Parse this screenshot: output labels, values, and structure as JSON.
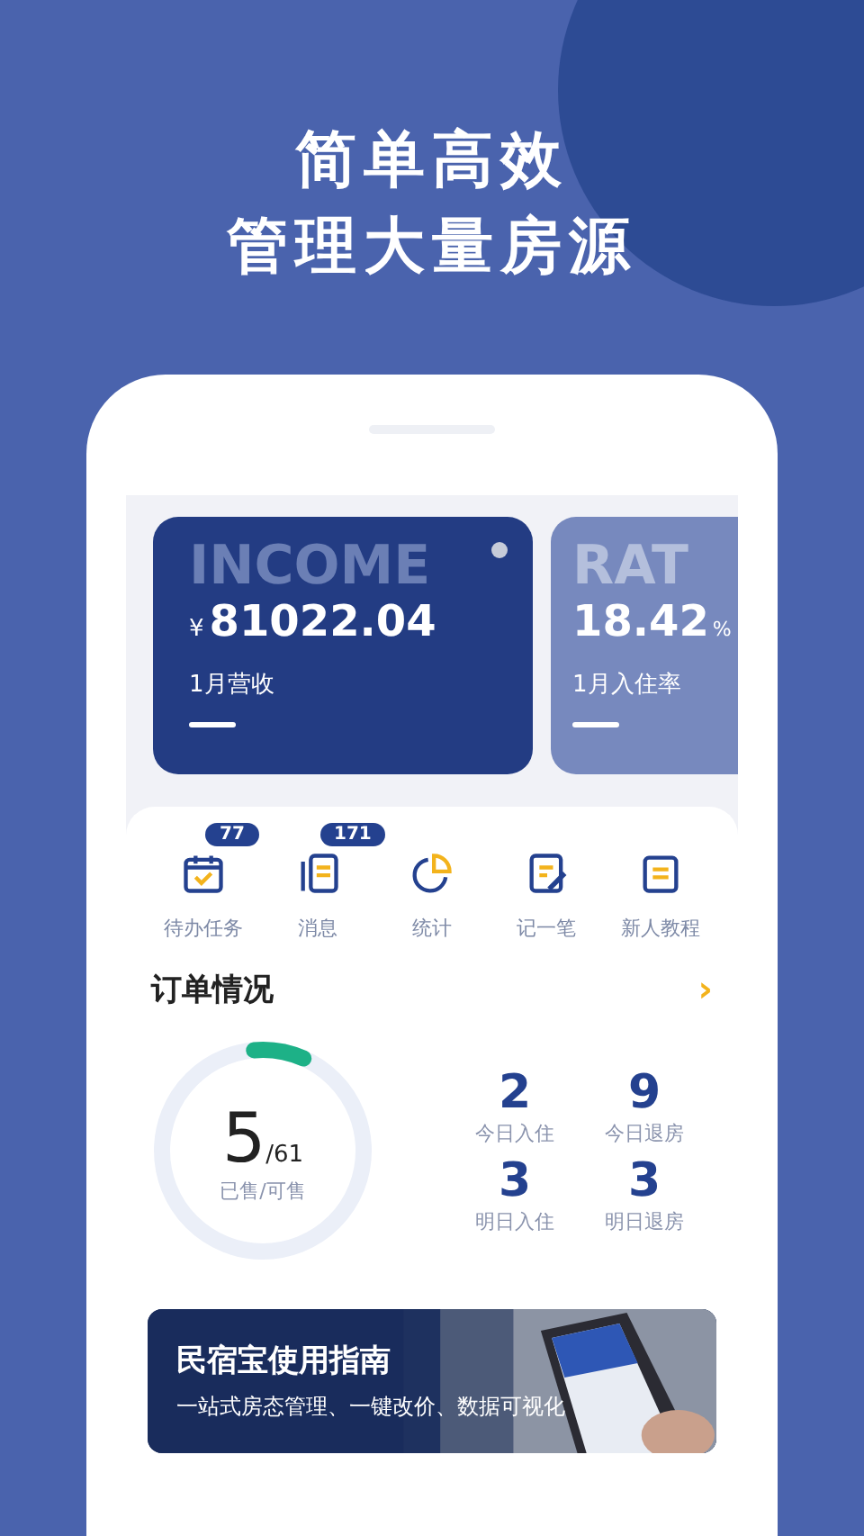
{
  "headline": [
    "简单高效",
    "管理大量房源"
  ],
  "cards": [
    {
      "watermark": "INCOME",
      "currency": "¥",
      "value": "81022.04",
      "label": "1月营收",
      "kind": "primary"
    },
    {
      "watermark": "RAT",
      "value": "18.42",
      "unit": "%",
      "label": "1月入住率",
      "kind": "secondary"
    }
  ],
  "shortcuts": [
    {
      "label": "待办任务",
      "badge": "77"
    },
    {
      "label": "消息",
      "badge": "171"
    },
    {
      "label": "统计"
    },
    {
      "label": "记一笔"
    },
    {
      "label": "新人教程"
    }
  ],
  "orders": {
    "title": "订单情况",
    "arrow": "›",
    "sold": "5",
    "available": "/61",
    "caption": "已售/可售",
    "level": 0.08,
    "stats": [
      {
        "value": "2",
        "label": "今日入住"
      },
      {
        "value": "9",
        "label": "今日退房"
      },
      {
        "value": "3",
        "label": "明日入住"
      },
      {
        "value": "3",
        "label": "明日退房"
      }
    ]
  },
  "banner": {
    "title": "民宿宝使用指南",
    "subtitle": "一站式房态管理、一键改价、数据可视化"
  }
}
